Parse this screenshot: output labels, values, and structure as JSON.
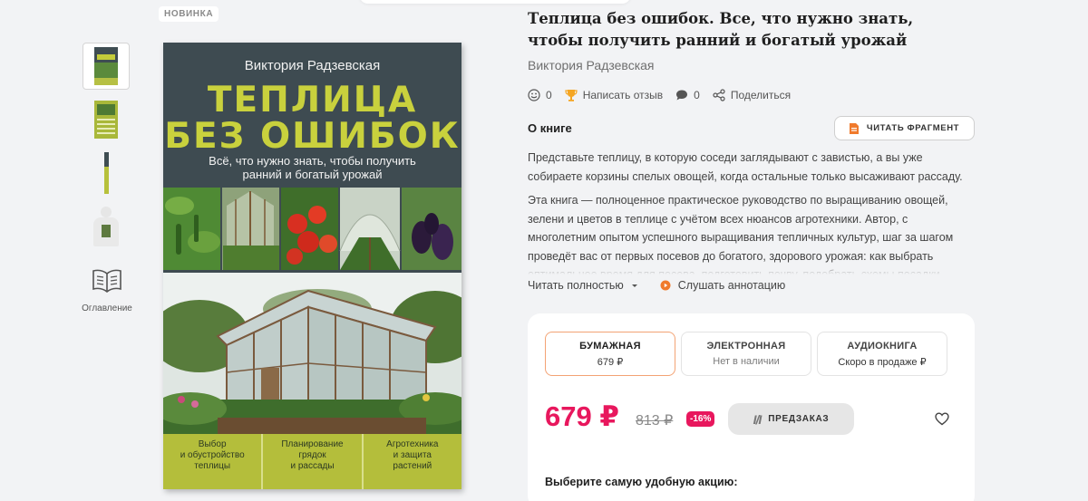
{
  "badge": "НОВИНКА",
  "thumbnails": [
    {
      "name": "front-cover"
    },
    {
      "name": "back-cover"
    },
    {
      "name": "spine"
    },
    {
      "name": "person-with-book"
    }
  ],
  "toc_label": "Оглавление",
  "cover": {
    "author": "Виктория Радзевская",
    "title_line1": "ТЕПЛИЦА",
    "title_line2": "БЕЗ ОШИБОК",
    "subtitle_line1": "Всё, что нужно знать, чтобы получить",
    "subtitle_line2": "ранний и богатый урожай",
    "bottom_col1_l1": "Выбор",
    "bottom_col1_l2": "и обустройство",
    "bottom_col1_l3": "теплицы",
    "bottom_col2_l1": "Планирование",
    "bottom_col2_l2": "грядок",
    "bottom_col2_l3": "и рассады",
    "bottom_col3_l1": "Агротехника",
    "bottom_col3_l2": "и защита",
    "bottom_col3_l3": "растений"
  },
  "book": {
    "title": "Теплица без ошибок. Все, что нужно знать, чтобы получить ранний и богатый урожай",
    "author": "Виктория Радзевская"
  },
  "stats": {
    "rating_count": "0",
    "review_label": "Написать отзыв",
    "comments_count": "0",
    "share_label": "Поделиться"
  },
  "about": {
    "title": "О книге",
    "read_fragment": "ЧИТАТЬ ФРАГМЕНТ",
    "p1": "Представьте теплицу, в которую соседи заглядывают с завистью, а вы уже собираете корзины спелых овощей, когда остальные только высаживают рассаду.",
    "p2": "Эта книга — полноценное практическое руководство по выращиванию овощей, зелени и цветов в теплице с учётом всех нюансов агротехники. Автор, с многолетним опытом успешного выращивания тепличных культур, шаг за шагом проведёт вас от первых посевов до богатого, здорового урожая: как выбрать оптимальное время для посева, подготовить почву, подобрать схемы посадки",
    "read_more": "Читать полностью",
    "listen": "Слушать аннотацию"
  },
  "purchase": {
    "tabs": [
      {
        "label": "БУМАЖНАЯ",
        "sub": "679 ₽"
      },
      {
        "label": "ЭЛЕКТРОННАЯ",
        "sub": "Нет в наличии"
      },
      {
        "label": "АУДИОКНИГА",
        "sub": "Скоро в продаже ₽"
      }
    ],
    "price": "679 ₽",
    "old_price": "813 ₽",
    "discount": "-16%",
    "preorder": "ПРЕДЗАКАЗ",
    "promo_title": "Выберите самую удобную акцию:"
  },
  "colors": {
    "accent": "#e8175d",
    "active_tab_border": "#f3a374",
    "cover_bg": "#3e4b51",
    "cover_title": "#c9d13d"
  }
}
